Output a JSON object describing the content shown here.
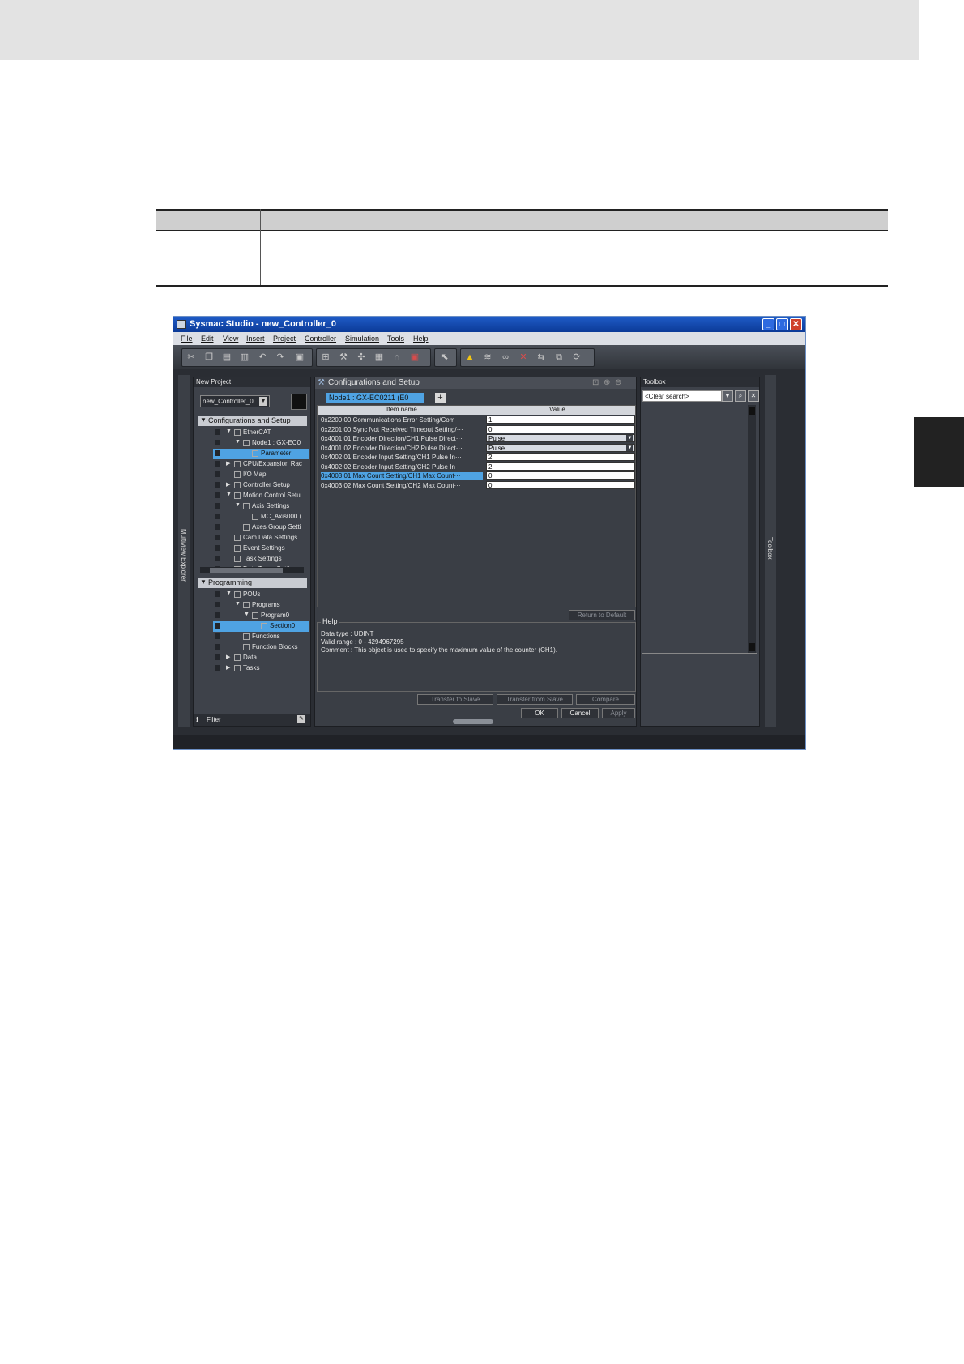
{
  "window": {
    "title": "Sysmac Studio - new_Controller_0",
    "controls": {
      "minimize": "_",
      "maximize": "□",
      "close": "✕"
    }
  },
  "menu": [
    "File",
    "Edit",
    "View",
    "Insert",
    "Project",
    "Controller",
    "Simulation",
    "Tools",
    "Help"
  ],
  "side_labels": {
    "left": "Multiview Explorer",
    "right": "Toolbox"
  },
  "explorer": {
    "header": "New Project",
    "project_select": "new_Controller_0",
    "config_header": "Configurations and Setup",
    "config_tree": [
      {
        "label": "EtherCAT",
        "indent": 0,
        "expand": "▼"
      },
      {
        "label": "Node1 : GX-EC0",
        "indent": 1,
        "expand": "▼"
      },
      {
        "label": "Parameter",
        "indent": 2,
        "expand": "",
        "selected": true
      },
      {
        "label": "CPU/Expansion Rac",
        "indent": 0,
        "expand": "▶"
      },
      {
        "label": "I/O Map",
        "indent": 0,
        "expand": ""
      },
      {
        "label": "Controller Setup",
        "indent": 0,
        "expand": "▶"
      },
      {
        "label": "Motion Control Setu",
        "indent": 0,
        "expand": "▼"
      },
      {
        "label": "Axis Settings",
        "indent": 1,
        "expand": "▼"
      },
      {
        "label": "MC_Axis000 (",
        "indent": 2,
        "expand": ""
      },
      {
        "label": "Axes Group Setti",
        "indent": 1,
        "expand": ""
      },
      {
        "label": "Cam Data Settings",
        "indent": 0,
        "expand": ""
      },
      {
        "label": "Event Settings",
        "indent": 0,
        "expand": ""
      },
      {
        "label": "Task Settings",
        "indent": 0,
        "expand": ""
      },
      {
        "label": "Data Trace Settings",
        "indent": 0,
        "expand": ""
      }
    ],
    "prog_header": "Programming",
    "prog_tree": [
      {
        "label": "POUs",
        "indent": 0,
        "expand": "▼"
      },
      {
        "label": "Programs",
        "indent": 1,
        "expand": "▼"
      },
      {
        "label": "Program0",
        "indent": 2,
        "expand": "▼"
      },
      {
        "label": "Section0",
        "indent": 3,
        "expand": "",
        "selected": true
      },
      {
        "label": "Functions",
        "indent": 1,
        "expand": ""
      },
      {
        "label": "Function Blocks",
        "indent": 1,
        "expand": ""
      },
      {
        "label": "Data",
        "indent": 0,
        "expand": "▶"
      },
      {
        "label": "Tasks",
        "indent": 0,
        "expand": "▶"
      }
    ],
    "filter_label": "Filter"
  },
  "editor": {
    "title": "Configurations and Setup",
    "tab": "Node1 : GX-EC0211 (E0",
    "col_name": "Item name",
    "col_value": "Value",
    "rows": [
      {
        "name": "0x2200:00 Communications Error Setting/Com···",
        "value": "1"
      },
      {
        "name": "0x2201:00 Sync Not Received Timeout Setting/···",
        "value": "0"
      },
      {
        "name": "0x4001:01 Encoder Direction/CH1 Pulse Direct···",
        "value": "Pulse",
        "dropdown": true
      },
      {
        "name": "0x4001:02 Encoder Direction/CH2 Pulse Direct···",
        "value": "Pulse",
        "dropdown": true
      },
      {
        "name": "0x4002:01 Encoder Input Setting/CH1 Pulse In···",
        "value": "2"
      },
      {
        "name": "0x4002:02 Encoder Input Setting/CH2 Pulse In···",
        "value": "2"
      },
      {
        "name": "0x4003:01 Max Count Setting/CH1 Max Count···",
        "value": "0",
        "selected": true
      },
      {
        "name": "0x4003:02 Max Count Setting/CH2 Max Count···",
        "value": "0"
      }
    ],
    "return_default": "Return to Default",
    "help": {
      "title": "Help",
      "data_type": "Data type    : UDINT",
      "valid_range": "Valid range : 0 - 4294967295",
      "comment": "Comment    : This object is used to specify the maximum value of the counter (CH1)."
    },
    "buttons": {
      "transfer_to": "Transfer to Slave",
      "transfer_from": "Transfer from Slave",
      "compare": "Compare",
      "ok": "OK",
      "cancel": "Cancel",
      "apply": "Apply"
    }
  },
  "toolbox": {
    "header": "Toolbox",
    "search": "<Clear search>"
  },
  "colors": {
    "selection": "#4fa3e3",
    "titlebar": "#1f5bc6",
    "panel": "#3e424a"
  }
}
